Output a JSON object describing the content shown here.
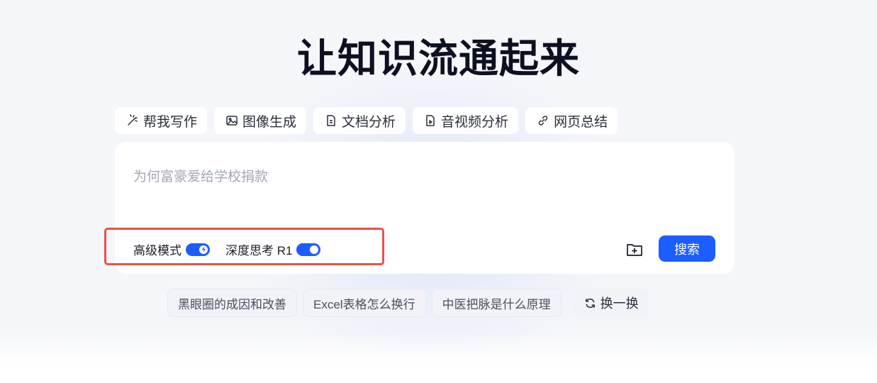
{
  "title": "让知识流通起来",
  "tools": [
    {
      "label": "帮我写作",
      "icon": "magic-wand-icon"
    },
    {
      "label": "图像生成",
      "icon": "image-icon"
    },
    {
      "label": "文档分析",
      "icon": "document-icon"
    },
    {
      "label": "音视频分析",
      "icon": "media-file-icon"
    },
    {
      "label": "网页总结",
      "icon": "link-icon"
    }
  ],
  "input": {
    "placeholder": "为何富豪爱给学校捐款"
  },
  "modes": {
    "advanced": {
      "label": "高级模式",
      "on": true,
      "icon": "lightning-icon"
    },
    "deep_think": {
      "label": "深度思考 R1",
      "on": true
    }
  },
  "actions": {
    "upload_icon": "folder-plus-icon",
    "search_label": "搜索"
  },
  "suggestions": [
    "黑眼圈的成因和改善",
    "Excel表格怎么换行",
    "中医把脉是什么原理"
  ],
  "refresh_label": "换一换",
  "colors": {
    "accent": "#1c5dff",
    "highlight": "#e8524a",
    "background": "#f5f6fa"
  }
}
